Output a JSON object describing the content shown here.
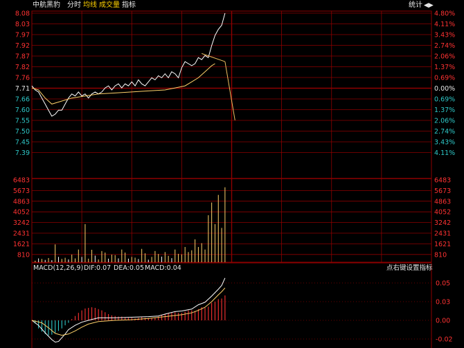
{
  "header": {
    "stock_name": "中航黑豹",
    "tab_timeshare": "分时",
    "tab_avg": "均线",
    "tab_volume": "成交量",
    "tab_indicator": "指标",
    "stats_button": "统计"
  },
  "colors": {
    "grid": "#8e0000",
    "price": "#ffffff",
    "avg": "#ffd26a",
    "up": "#ff3232",
    "down": "#2ec7c7",
    "label": "#e7c84f",
    "text": "#e6e6e6",
    "tab_active": "#ffd200"
  },
  "price_axis": {
    "left_ticks": [
      "8.08",
      "8.03",
      "7.97",
      "7.92",
      "7.87",
      "7.82",
      "7.76",
      "7.71",
      "7.66",
      "7.60",
      "7.55",
      "7.50",
      "7.45",
      "7.39"
    ],
    "right_ticks": [
      "4.80%",
      "4.11%",
      "3.43%",
      "2.74%",
      "2.06%",
      "1.37%",
      "0.69%",
      "0.00%",
      "0.69%",
      "1.37%",
      "2.06%",
      "2.74%",
      "3.43%",
      "4.11%"
    ],
    "reference_price": 7.71
  },
  "volume_axis": {
    "ticks": [
      "6483",
      "5673",
      "4863",
      "4052",
      "3242",
      "2431",
      "1621",
      "810"
    ]
  },
  "macd": {
    "title": "MACD(12,26,9)",
    "dif_label": "DIF:0.07",
    "dea_label": "DEA:0.05",
    "macd_label": "MACD:0.04",
    "settings_hint": "点右键设置指标",
    "ticks": [
      "0.05",
      "0.03",
      "0.00",
      "-0.02"
    ]
  },
  "chart_data": {
    "type": "line",
    "price_series": [
      [
        0,
        7.72
      ],
      [
        2,
        7.7
      ],
      [
        4,
        7.69
      ],
      [
        6,
        7.66
      ],
      [
        8,
        7.63
      ],
      [
        10,
        7.6
      ],
      [
        12,
        7.57
      ],
      [
        14,
        7.58
      ],
      [
        16,
        7.6
      ],
      [
        18,
        7.6
      ],
      [
        20,
        7.63
      ],
      [
        22,
        7.66
      ],
      [
        24,
        7.68
      ],
      [
        26,
        7.67
      ],
      [
        28,
        7.69
      ],
      [
        30,
        7.67
      ],
      [
        32,
        7.68
      ],
      [
        34,
        7.66
      ],
      [
        36,
        7.68
      ],
      [
        38,
        7.69
      ],
      [
        40,
        7.68
      ],
      [
        42,
        7.69
      ],
      [
        44,
        7.71
      ],
      [
        46,
        7.72
      ],
      [
        48,
        7.7
      ],
      [
        50,
        7.72
      ],
      [
        52,
        7.73
      ],
      [
        54,
        7.71
      ],
      [
        56,
        7.73
      ],
      [
        58,
        7.72
      ],
      [
        60,
        7.74
      ],
      [
        62,
        7.72
      ],
      [
        64,
        7.75
      ],
      [
        66,
        7.73
      ],
      [
        68,
        7.72
      ],
      [
        70,
        7.74
      ],
      [
        72,
        7.76
      ],
      [
        74,
        7.75
      ],
      [
        76,
        7.77
      ],
      [
        78,
        7.76
      ],
      [
        80,
        7.78
      ],
      [
        82,
        7.76
      ],
      [
        84,
        7.79
      ],
      [
        86,
        7.78
      ],
      [
        88,
        7.76
      ],
      [
        90,
        7.81
      ],
      [
        92,
        7.84
      ],
      [
        94,
        7.83
      ],
      [
        96,
        7.82
      ],
      [
        98,
        7.83
      ],
      [
        100,
        7.86
      ],
      [
        102,
        7.85
      ],
      [
        104,
        7.87
      ],
      [
        106,
        7.86
      ],
      [
        108,
        7.92
      ],
      [
        110,
        7.97
      ],
      [
        112,
        8.0
      ],
      [
        114,
        8.02
      ],
      [
        116,
        8.08
      ]
    ],
    "avg_series": [
      [
        0,
        7.71
      ],
      [
        4,
        7.7
      ],
      [
        8,
        7.66
      ],
      [
        12,
        7.63
      ],
      [
        16,
        7.64
      ],
      [
        24,
        7.66
      ],
      [
        32,
        7.67
      ],
      [
        40,
        7.68
      ],
      [
        50,
        7.685
      ],
      [
        60,
        7.69
      ],
      [
        70,
        7.695
      ],
      [
        80,
        7.7
      ],
      [
        86,
        7.71
      ],
      [
        92,
        7.72
      ],
      [
        96,
        7.74
      ],
      [
        100,
        7.76
      ],
      [
        104,
        7.79
      ],
      [
        108,
        7.82
      ],
      [
        110,
        7.83
      ]
    ],
    "volume": [
      [
        2,
        120,
        "u"
      ],
      [
        4,
        300,
        "d"
      ],
      [
        6,
        260,
        "u"
      ],
      [
        8,
        180,
        "d"
      ],
      [
        10,
        330,
        "u"
      ],
      [
        12,
        160,
        "d"
      ],
      [
        14,
        1400,
        "u"
      ],
      [
        16,
        420,
        "d"
      ],
      [
        18,
        260,
        "u"
      ],
      [
        20,
        350,
        "u"
      ],
      [
        22,
        220,
        "d"
      ],
      [
        24,
        600,
        "u"
      ],
      [
        26,
        300,
        "u"
      ],
      [
        28,
        1000,
        "u"
      ],
      [
        30,
        420,
        "d"
      ],
      [
        32,
        3000,
        "u"
      ],
      [
        34,
        280,
        "u"
      ],
      [
        36,
        980,
        "u"
      ],
      [
        38,
        520,
        "d"
      ],
      [
        40,
        220,
        "u"
      ],
      [
        42,
        880,
        "u"
      ],
      [
        44,
        760,
        "u"
      ],
      [
        46,
        280,
        "d"
      ],
      [
        48,
        600,
        "u"
      ],
      [
        50,
        560,
        "u"
      ],
      [
        52,
        300,
        "d"
      ],
      [
        54,
        1000,
        "u"
      ],
      [
        56,
        760,
        "u"
      ],
      [
        58,
        280,
        "d"
      ],
      [
        60,
        420,
        "u"
      ],
      [
        62,
        360,
        "u"
      ],
      [
        64,
        250,
        "d"
      ],
      [
        66,
        1050,
        "u"
      ],
      [
        68,
        700,
        "u"
      ],
      [
        70,
        200,
        "d"
      ],
      [
        72,
        420,
        "u"
      ],
      [
        74,
        880,
        "u"
      ],
      [
        76,
        650,
        "u"
      ],
      [
        78,
        440,
        "d"
      ],
      [
        80,
        800,
        "u"
      ],
      [
        82,
        500,
        "u"
      ],
      [
        84,
        320,
        "d"
      ],
      [
        86,
        1000,
        "u"
      ],
      [
        88,
        660,
        "u"
      ],
      [
        90,
        620,
        "u"
      ],
      [
        92,
        1200,
        "u"
      ],
      [
        94,
        800,
        "u"
      ],
      [
        96,
        940,
        "u"
      ],
      [
        98,
        1800,
        "u"
      ],
      [
        100,
        1200,
        "u"
      ],
      [
        102,
        1500,
        "u"
      ],
      [
        104,
        1000,
        "u"
      ],
      [
        106,
        3700,
        "u"
      ],
      [
        108,
        4700,
        "u"
      ],
      [
        110,
        3000,
        "u"
      ],
      [
        112,
        5300,
        "u"
      ],
      [
        114,
        2700,
        "u"
      ],
      [
        116,
        5900,
        "u"
      ]
    ],
    "volume_max": 6483,
    "macd_bars": [
      [
        2,
        -0.005
      ],
      [
        4,
        -0.013
      ],
      [
        6,
        -0.018
      ],
      [
        8,
        -0.022
      ],
      [
        10,
        -0.024
      ],
      [
        12,
        -0.023
      ],
      [
        14,
        -0.02
      ],
      [
        16,
        -0.017
      ],
      [
        18,
        -0.013
      ],
      [
        20,
        -0.008
      ],
      [
        22,
        -0.004
      ],
      [
        24,
        0.002
      ],
      [
        26,
        0.007
      ],
      [
        28,
        0.012
      ],
      [
        30,
        0.016
      ],
      [
        32,
        0.019
      ],
      [
        34,
        0.02
      ],
      [
        36,
        0.021
      ],
      [
        38,
        0.02
      ],
      [
        40,
        0.018
      ],
      [
        42,
        0.016
      ],
      [
        44,
        0.013
      ],
      [
        46,
        0.01
      ],
      [
        48,
        0.008
      ],
      [
        50,
        0.007
      ],
      [
        52,
        0.006
      ],
      [
        54,
        0.006
      ],
      [
        56,
        0.005
      ],
      [
        58,
        0.004
      ],
      [
        60,
        0.004
      ],
      [
        62,
        0.003
      ],
      [
        64,
        0.004
      ],
      [
        66,
        0.005
      ],
      [
        68,
        0.004
      ],
      [
        70,
        0.004
      ],
      [
        72,
        0.004
      ],
      [
        74,
        0.004
      ],
      [
        76,
        0.006
      ],
      [
        78,
        0.008
      ],
      [
        80,
        0.01
      ],
      [
        82,
        0.011
      ],
      [
        84,
        0.012
      ],
      [
        86,
        0.013
      ],
      [
        88,
        0.012
      ],
      [
        90,
        0.012
      ],
      [
        92,
        0.014
      ],
      [
        94,
        0.016
      ],
      [
        96,
        0.016
      ],
      [
        98,
        0.015
      ],
      [
        100,
        0.018
      ],
      [
        102,
        0.021
      ],
      [
        104,
        0.02
      ],
      [
        106,
        0.022
      ],
      [
        108,
        0.028
      ],
      [
        110,
        0.03
      ],
      [
        112,
        0.034
      ],
      [
        114,
        0.035
      ],
      [
        116,
        0.04
      ]
    ],
    "dif_series": [
      [
        0,
        0.0
      ],
      [
        4,
        -0.008
      ],
      [
        8,
        -0.02
      ],
      [
        12,
        -0.031
      ],
      [
        14,
        -0.035
      ],
      [
        16,
        -0.034
      ],
      [
        18,
        -0.028
      ],
      [
        20,
        -0.022
      ],
      [
        22,
        -0.015
      ],
      [
        26,
        -0.008
      ],
      [
        30,
        -0.003
      ],
      [
        34,
        0.0
      ],
      [
        40,
        0.004
      ],
      [
        50,
        0.004
      ],
      [
        60,
        0.005
      ],
      [
        70,
        0.006
      ],
      [
        76,
        0.007
      ],
      [
        80,
        0.01
      ],
      [
        86,
        0.014
      ],
      [
        90,
        0.015
      ],
      [
        96,
        0.018
      ],
      [
        100,
        0.025
      ],
      [
        104,
        0.029
      ],
      [
        108,
        0.039
      ],
      [
        112,
        0.05
      ],
      [
        114,
        0.056
      ],
      [
        116,
        0.068
      ]
    ],
    "dea_series": [
      [
        0,
        0.0
      ],
      [
        6,
        -0.004
      ],
      [
        10,
        -0.012
      ],
      [
        14,
        -0.021
      ],
      [
        18,
        -0.024
      ],
      [
        22,
        -0.022
      ],
      [
        26,
        -0.017
      ],
      [
        30,
        -0.011
      ],
      [
        34,
        -0.006
      ],
      [
        40,
        -0.002
      ],
      [
        50,
        0.0
      ],
      [
        60,
        0.001
      ],
      [
        70,
        0.003
      ],
      [
        80,
        0.006
      ],
      [
        90,
        0.009
      ],
      [
        96,
        0.012
      ],
      [
        100,
        0.016
      ],
      [
        104,
        0.021
      ],
      [
        108,
        0.03
      ],
      [
        112,
        0.041
      ],
      [
        114,
        0.046
      ],
      [
        116,
        0.052
      ]
    ],
    "annotation_arrow": [
      [
        116,
        7.84
      ],
      [
        102,
        7.88
      ],
      [
        122,
        7.55
      ]
    ],
    "xlim": [
      0,
      240
    ]
  }
}
